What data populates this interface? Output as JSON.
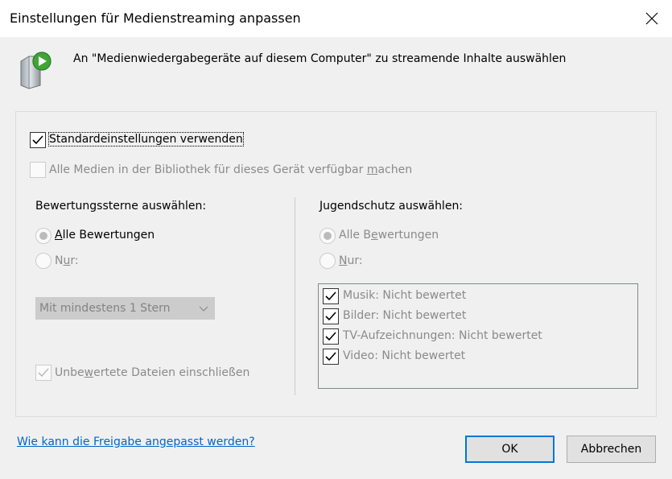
{
  "window": {
    "title": "Einstellungen für Medienstreaming anpassen",
    "close_icon": "close-icon"
  },
  "header": {
    "icon": "media-device-icon",
    "description": "An \"Medienwiedergabegeräte auf diesem Computer\" zu streamende Inhalte auswählen"
  },
  "options": {
    "use_defaults": {
      "label": "Standardeinstellungen verwenden",
      "checked": true
    },
    "all_media": {
      "label_pre": "Alle Medien in der Bibliothek für dieses Gerät verfügbar ",
      "label_u": "m",
      "label_post": "achen",
      "checked": false,
      "enabled": false
    }
  },
  "ratings": {
    "heading": "Bewertungssterne auswählen:",
    "all": {
      "pre": "",
      "u": "A",
      "post": "lle Bewertungen",
      "selected": true
    },
    "only": {
      "pre": "N",
      "u": "u",
      "post": "r:",
      "selected": false
    },
    "dropdown_value": "Mit mindestens 1 Stern",
    "unrated": {
      "pre": "Unbe",
      "u": "w",
      "post": "ertete Dateien einschließen",
      "checked": true
    }
  },
  "parental": {
    "heading": "Jugendschutz auswählen:",
    "all": {
      "pre": "Alle B",
      "u": "e",
      "post": "wertungen",
      "selected": true
    },
    "only": {
      "pre": "",
      "u": "N",
      "post": "ur:",
      "selected": false
    },
    "items": [
      {
        "label": "Musik: Nicht bewertet",
        "checked": true
      },
      {
        "label": "Bilder: Nicht bewertet",
        "checked": true
      },
      {
        "label": "TV-Aufzeichnungen: Nicht bewertet",
        "checked": true
      },
      {
        "label": "Video: Nicht bewertet",
        "checked": true
      }
    ]
  },
  "footer": {
    "help_link": "Wie kann die Freigabe angepasst werden?",
    "ok_label": "OK",
    "cancel_label": "Abbrechen"
  },
  "colors": {
    "accent": "#0078d7",
    "link": "#0066cc",
    "disabled_text": "#8a8a8a"
  }
}
